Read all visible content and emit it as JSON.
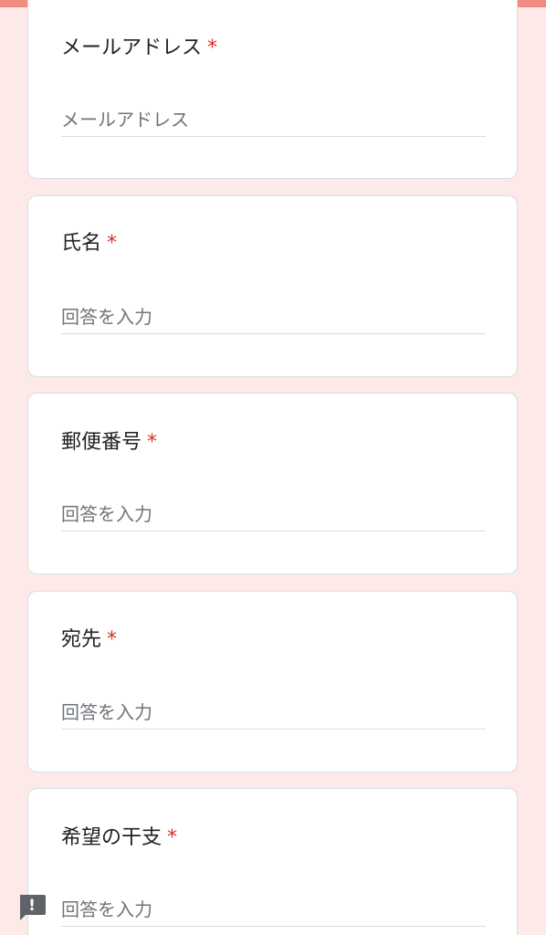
{
  "theme": {
    "accent": "#f28b82",
    "background": "#fde9e7",
    "required": "#d93025"
  },
  "questions": [
    {
      "title": "メールアドレス",
      "required_mark": "*",
      "placeholder": "メールアドレス"
    },
    {
      "title": "氏名",
      "required_mark": "*",
      "placeholder": "回答を入力"
    },
    {
      "title": "郵便番号",
      "required_mark": "*",
      "placeholder": "回答を入力"
    },
    {
      "title": "宛先",
      "required_mark": "*",
      "placeholder": "回答を入力"
    },
    {
      "title": "希望の干支",
      "required_mark": "*",
      "placeholder": "回答を入力"
    }
  ],
  "feedback": {
    "icon": "feedback-icon",
    "glyph": "!"
  }
}
